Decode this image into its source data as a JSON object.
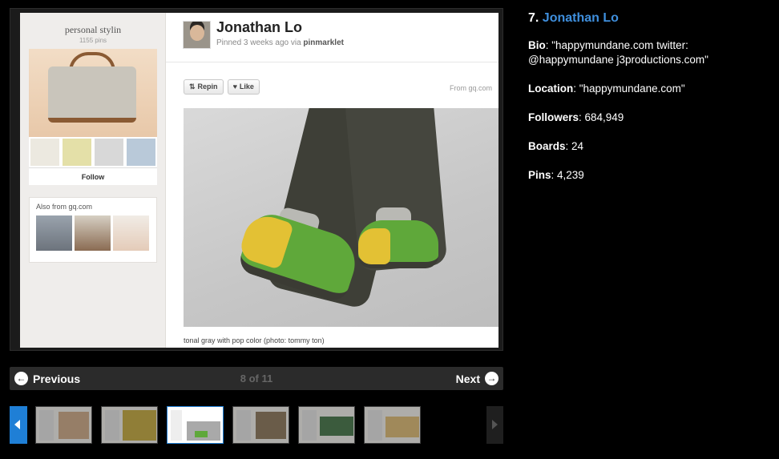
{
  "board": {
    "name": "personal stylin",
    "pins": "1155 pins",
    "follow_label": "Follow"
  },
  "also_from": {
    "title": "Also from gq.com"
  },
  "pin": {
    "pinner": "Jonathan Lo",
    "meta_prefix": "Pinned 3 weeks ago via ",
    "meta_source": "pinmarklet",
    "repin_label": "Repin",
    "like_label": "Like",
    "from": "From gq.com",
    "caption": "tonal gray with pop color (photo: tommy ton)"
  },
  "nav": {
    "previous": "Previous",
    "next": "Next",
    "count": "8 of 11"
  },
  "info": {
    "rank": "7.",
    "name": "Jonathan Lo",
    "bio_label": "Bio",
    "bio_value": ": \"happymundane.com twitter: @happymundane j3productions.com\"",
    "location_label": "Location",
    "location_value": ": \"happymundane.com\"",
    "followers_label": "Followers",
    "followers_value": ": 684,949",
    "boards_label": "Boards",
    "boards_value": ": 24",
    "pins_label": "Pins",
    "pins_value": ": 4,239"
  },
  "colors": {
    "link_blue": "#3f8fdd",
    "strip_active": "#1f7fd6"
  }
}
